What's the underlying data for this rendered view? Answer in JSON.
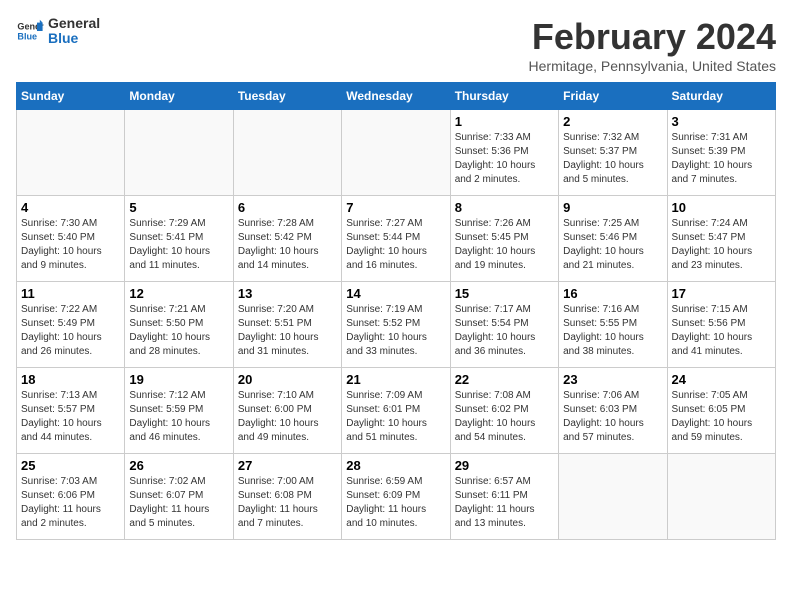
{
  "logo": {
    "line1": "General",
    "line2": "Blue"
  },
  "title": "February 2024",
  "subtitle": "Hermitage, Pennsylvania, United States",
  "days_of_week": [
    "Sunday",
    "Monday",
    "Tuesday",
    "Wednesday",
    "Thursday",
    "Friday",
    "Saturday"
  ],
  "weeks": [
    [
      {
        "day": "",
        "info": ""
      },
      {
        "day": "",
        "info": ""
      },
      {
        "day": "",
        "info": ""
      },
      {
        "day": "",
        "info": ""
      },
      {
        "day": "1",
        "info": "Sunrise: 7:33 AM\nSunset: 5:36 PM\nDaylight: 10 hours\nand 2 minutes."
      },
      {
        "day": "2",
        "info": "Sunrise: 7:32 AM\nSunset: 5:37 PM\nDaylight: 10 hours\nand 5 minutes."
      },
      {
        "day": "3",
        "info": "Sunrise: 7:31 AM\nSunset: 5:39 PM\nDaylight: 10 hours\nand 7 minutes."
      }
    ],
    [
      {
        "day": "4",
        "info": "Sunrise: 7:30 AM\nSunset: 5:40 PM\nDaylight: 10 hours\nand 9 minutes."
      },
      {
        "day": "5",
        "info": "Sunrise: 7:29 AM\nSunset: 5:41 PM\nDaylight: 10 hours\nand 11 minutes."
      },
      {
        "day": "6",
        "info": "Sunrise: 7:28 AM\nSunset: 5:42 PM\nDaylight: 10 hours\nand 14 minutes."
      },
      {
        "day": "7",
        "info": "Sunrise: 7:27 AM\nSunset: 5:44 PM\nDaylight: 10 hours\nand 16 minutes."
      },
      {
        "day": "8",
        "info": "Sunrise: 7:26 AM\nSunset: 5:45 PM\nDaylight: 10 hours\nand 19 minutes."
      },
      {
        "day": "9",
        "info": "Sunrise: 7:25 AM\nSunset: 5:46 PM\nDaylight: 10 hours\nand 21 minutes."
      },
      {
        "day": "10",
        "info": "Sunrise: 7:24 AM\nSunset: 5:47 PM\nDaylight: 10 hours\nand 23 minutes."
      }
    ],
    [
      {
        "day": "11",
        "info": "Sunrise: 7:22 AM\nSunset: 5:49 PM\nDaylight: 10 hours\nand 26 minutes."
      },
      {
        "day": "12",
        "info": "Sunrise: 7:21 AM\nSunset: 5:50 PM\nDaylight: 10 hours\nand 28 minutes."
      },
      {
        "day": "13",
        "info": "Sunrise: 7:20 AM\nSunset: 5:51 PM\nDaylight: 10 hours\nand 31 minutes."
      },
      {
        "day": "14",
        "info": "Sunrise: 7:19 AM\nSunset: 5:52 PM\nDaylight: 10 hours\nand 33 minutes."
      },
      {
        "day": "15",
        "info": "Sunrise: 7:17 AM\nSunset: 5:54 PM\nDaylight: 10 hours\nand 36 minutes."
      },
      {
        "day": "16",
        "info": "Sunrise: 7:16 AM\nSunset: 5:55 PM\nDaylight: 10 hours\nand 38 minutes."
      },
      {
        "day": "17",
        "info": "Sunrise: 7:15 AM\nSunset: 5:56 PM\nDaylight: 10 hours\nand 41 minutes."
      }
    ],
    [
      {
        "day": "18",
        "info": "Sunrise: 7:13 AM\nSunset: 5:57 PM\nDaylight: 10 hours\nand 44 minutes."
      },
      {
        "day": "19",
        "info": "Sunrise: 7:12 AM\nSunset: 5:59 PM\nDaylight: 10 hours\nand 46 minutes."
      },
      {
        "day": "20",
        "info": "Sunrise: 7:10 AM\nSunset: 6:00 PM\nDaylight: 10 hours\nand 49 minutes."
      },
      {
        "day": "21",
        "info": "Sunrise: 7:09 AM\nSunset: 6:01 PM\nDaylight: 10 hours\nand 51 minutes."
      },
      {
        "day": "22",
        "info": "Sunrise: 7:08 AM\nSunset: 6:02 PM\nDaylight: 10 hours\nand 54 minutes."
      },
      {
        "day": "23",
        "info": "Sunrise: 7:06 AM\nSunset: 6:03 PM\nDaylight: 10 hours\nand 57 minutes."
      },
      {
        "day": "24",
        "info": "Sunrise: 7:05 AM\nSunset: 6:05 PM\nDaylight: 10 hours\nand 59 minutes."
      }
    ],
    [
      {
        "day": "25",
        "info": "Sunrise: 7:03 AM\nSunset: 6:06 PM\nDaylight: 11 hours\nand 2 minutes."
      },
      {
        "day": "26",
        "info": "Sunrise: 7:02 AM\nSunset: 6:07 PM\nDaylight: 11 hours\nand 5 minutes."
      },
      {
        "day": "27",
        "info": "Sunrise: 7:00 AM\nSunset: 6:08 PM\nDaylight: 11 hours\nand 7 minutes."
      },
      {
        "day": "28",
        "info": "Sunrise: 6:59 AM\nSunset: 6:09 PM\nDaylight: 11 hours\nand 10 minutes."
      },
      {
        "day": "29",
        "info": "Sunrise: 6:57 AM\nSunset: 6:11 PM\nDaylight: 11 hours\nand 13 minutes."
      },
      {
        "day": "",
        "info": ""
      },
      {
        "day": "",
        "info": ""
      }
    ]
  ]
}
